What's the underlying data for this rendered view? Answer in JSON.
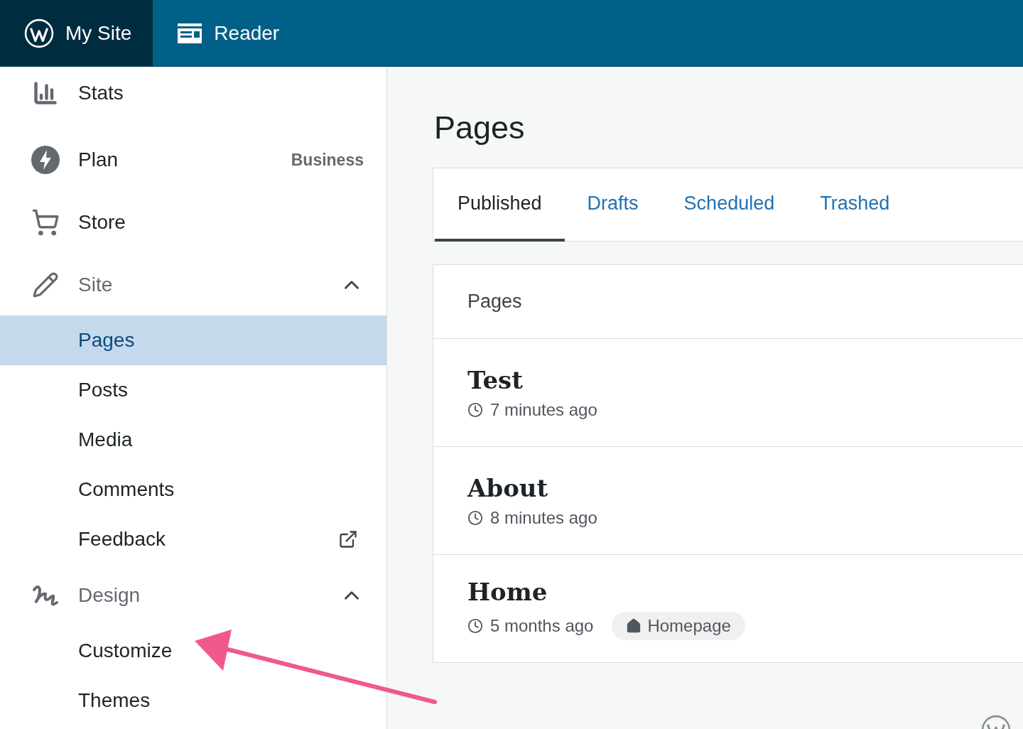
{
  "topbar": {
    "tabs": [
      {
        "label": "My Site",
        "kind": "site",
        "selected": true
      },
      {
        "label": "Reader",
        "kind": "reader",
        "selected": false
      }
    ]
  },
  "sidebar": {
    "items": [
      {
        "label": "Stats",
        "kind": "stats"
      },
      {
        "label": "Plan",
        "kind": "plan",
        "badge": "Business"
      },
      {
        "label": "Store",
        "kind": "store"
      },
      {
        "label": "Site",
        "kind": "site",
        "expanded": true,
        "children": [
          {
            "label": "Pages",
            "selected": true,
            "external": false
          },
          {
            "label": "Posts",
            "selected": false,
            "external": false
          },
          {
            "label": "Media",
            "selected": false,
            "external": false
          },
          {
            "label": "Comments",
            "selected": false,
            "external": false
          },
          {
            "label": "Feedback",
            "selected": false,
            "external": true
          }
        ]
      },
      {
        "label": "Design",
        "kind": "design",
        "expanded": true,
        "children": [
          {
            "label": "Customize",
            "selected": false,
            "external": false
          },
          {
            "label": "Themes",
            "selected": false,
            "external": false
          }
        ]
      }
    ]
  },
  "main": {
    "title": "Pages",
    "tabs": [
      {
        "label": "Published",
        "selected": true
      },
      {
        "label": "Drafts",
        "selected": false
      },
      {
        "label": "Scheduled",
        "selected": false
      },
      {
        "label": "Trashed",
        "selected": false
      }
    ],
    "list": {
      "header": "Pages",
      "rows": [
        {
          "title": "Test",
          "time": "7 minutes ago"
        },
        {
          "title": "About",
          "time": "8 minutes ago"
        },
        {
          "title": "Home",
          "time": "5 months ago",
          "badge": "Homepage"
        }
      ]
    }
  }
}
